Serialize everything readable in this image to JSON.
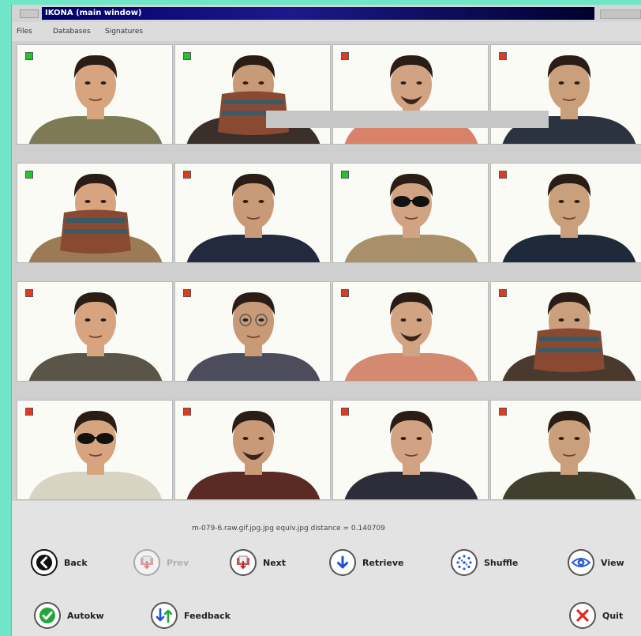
{
  "window": {
    "title": "IKONA (main window)"
  },
  "menu": [
    "Files",
    "Databases",
    "Signatures"
  ],
  "grid": {
    "flags": [
      "relevant",
      "relevant",
      "not-relevant",
      "not-relevant",
      "relevant",
      "not-relevant",
      "relevant",
      "not-relevant",
      "not-relevant",
      "not-relevant",
      "not-relevant",
      "not-relevant",
      "not-relevant",
      "not-relevant",
      "not-relevant",
      "not-relevant"
    ],
    "flag_colors": {
      "relevant": "#22c42a",
      "not-relevant": "#e33a1f"
    }
  },
  "status": "m-079-6.raw.gif.jpg.jpg equiv.jpg distance = 0.140709",
  "buttons": {
    "back": "Back",
    "prev": "Prev",
    "next": "Next",
    "retrieve": "Retrieve",
    "shuffle": "Shuffle",
    "view": "View",
    "autokw": "Autokw",
    "feedback": "Feedback",
    "quit": "Quit"
  },
  "icons": {
    "back": "arrow-left-icon",
    "prev": "prev-icon",
    "next": "next-icon",
    "retrieve": "arrow-down-icon",
    "shuffle": "shuffle-icon",
    "view": "eye-icon",
    "autokw": "checkmark-icon",
    "feedback": "feedback-arrows-icon",
    "quit": "close-icon"
  }
}
